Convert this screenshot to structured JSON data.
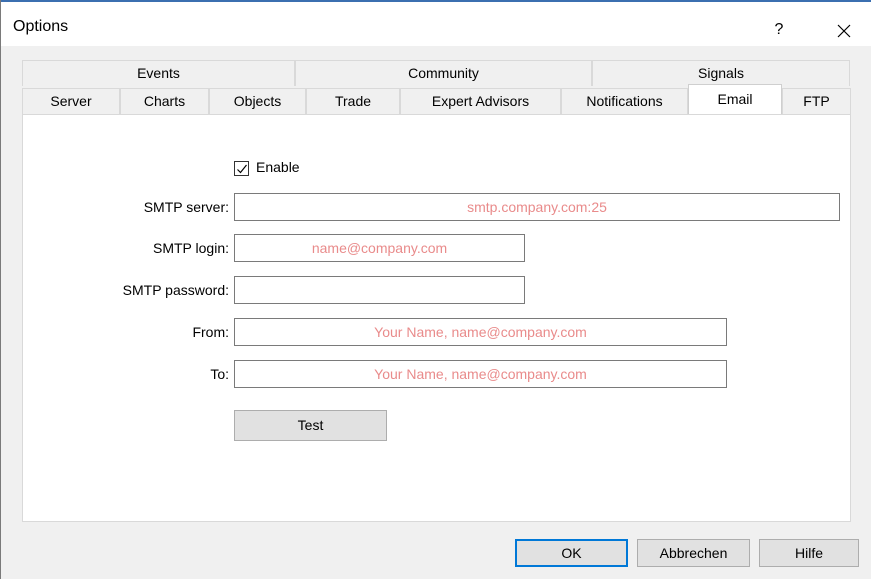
{
  "window": {
    "title": "Options",
    "help_glyph": "?"
  },
  "tabs_upper": [
    {
      "label": "Events"
    },
    {
      "label": "Community"
    },
    {
      "label": "Signals"
    }
  ],
  "tabs_lower": [
    {
      "label": "Server"
    },
    {
      "label": "Charts"
    },
    {
      "label": "Objects"
    },
    {
      "label": "Trade"
    },
    {
      "label": "Expert Advisors"
    },
    {
      "label": "Notifications"
    },
    {
      "label": "Email",
      "active": true
    },
    {
      "label": "FTP"
    }
  ],
  "form": {
    "enable_label": "Enable",
    "enable_checked": true,
    "smtp_server_label": "SMTP server:",
    "smtp_server_value": "smtp.company.com:25",
    "smtp_login_label": "SMTP login:",
    "smtp_login_value": "name@company.com",
    "smtp_password_label": "SMTP password:",
    "smtp_password_value": "",
    "from_label": "From:",
    "from_value": "Your Name, name@company.com",
    "to_label": "To:",
    "to_value": "Your Name, name@company.com",
    "test_label": "Test"
  },
  "buttons": {
    "ok": "OK",
    "cancel": "Abbrechen",
    "help": "Hilfe"
  },
  "colors": {
    "placeholder_text": "#e98b8b",
    "default_button_border": "#0078d7"
  }
}
